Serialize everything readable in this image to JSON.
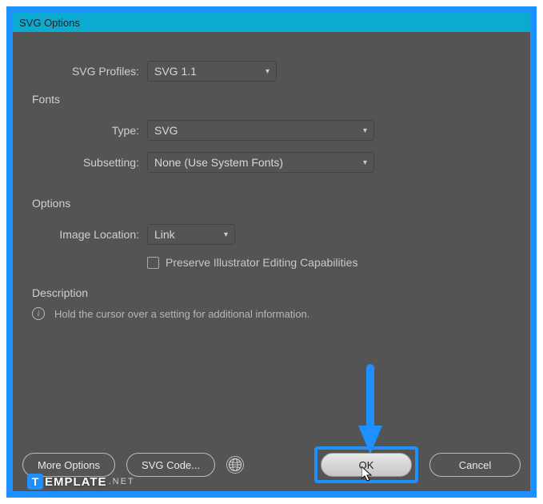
{
  "titlebar": {
    "title": "SVG Options"
  },
  "profiles": {
    "label": "SVG Profiles:",
    "value": "SVG 1.1"
  },
  "fonts": {
    "heading": "Fonts",
    "type": {
      "label": "Type:",
      "value": "SVG"
    },
    "subsetting": {
      "label": "Subsetting:",
      "value": "None (Use System Fonts)"
    }
  },
  "options": {
    "heading": "Options",
    "imageLocation": {
      "label": "Image Location:",
      "value": "Link"
    },
    "preserveCheckbox": {
      "label": "Preserve Illustrator Editing Capabilities",
      "checked": false
    }
  },
  "description": {
    "heading": "Description",
    "hint": "Hold the cursor over a setting for additional information."
  },
  "buttons": {
    "moreOptions": "More Options",
    "svgCode": "SVG Code...",
    "ok": "OK",
    "cancel": "Cancel"
  },
  "watermark": {
    "badge": "T",
    "text": "EMPLATE",
    "suffix": ".NET"
  }
}
